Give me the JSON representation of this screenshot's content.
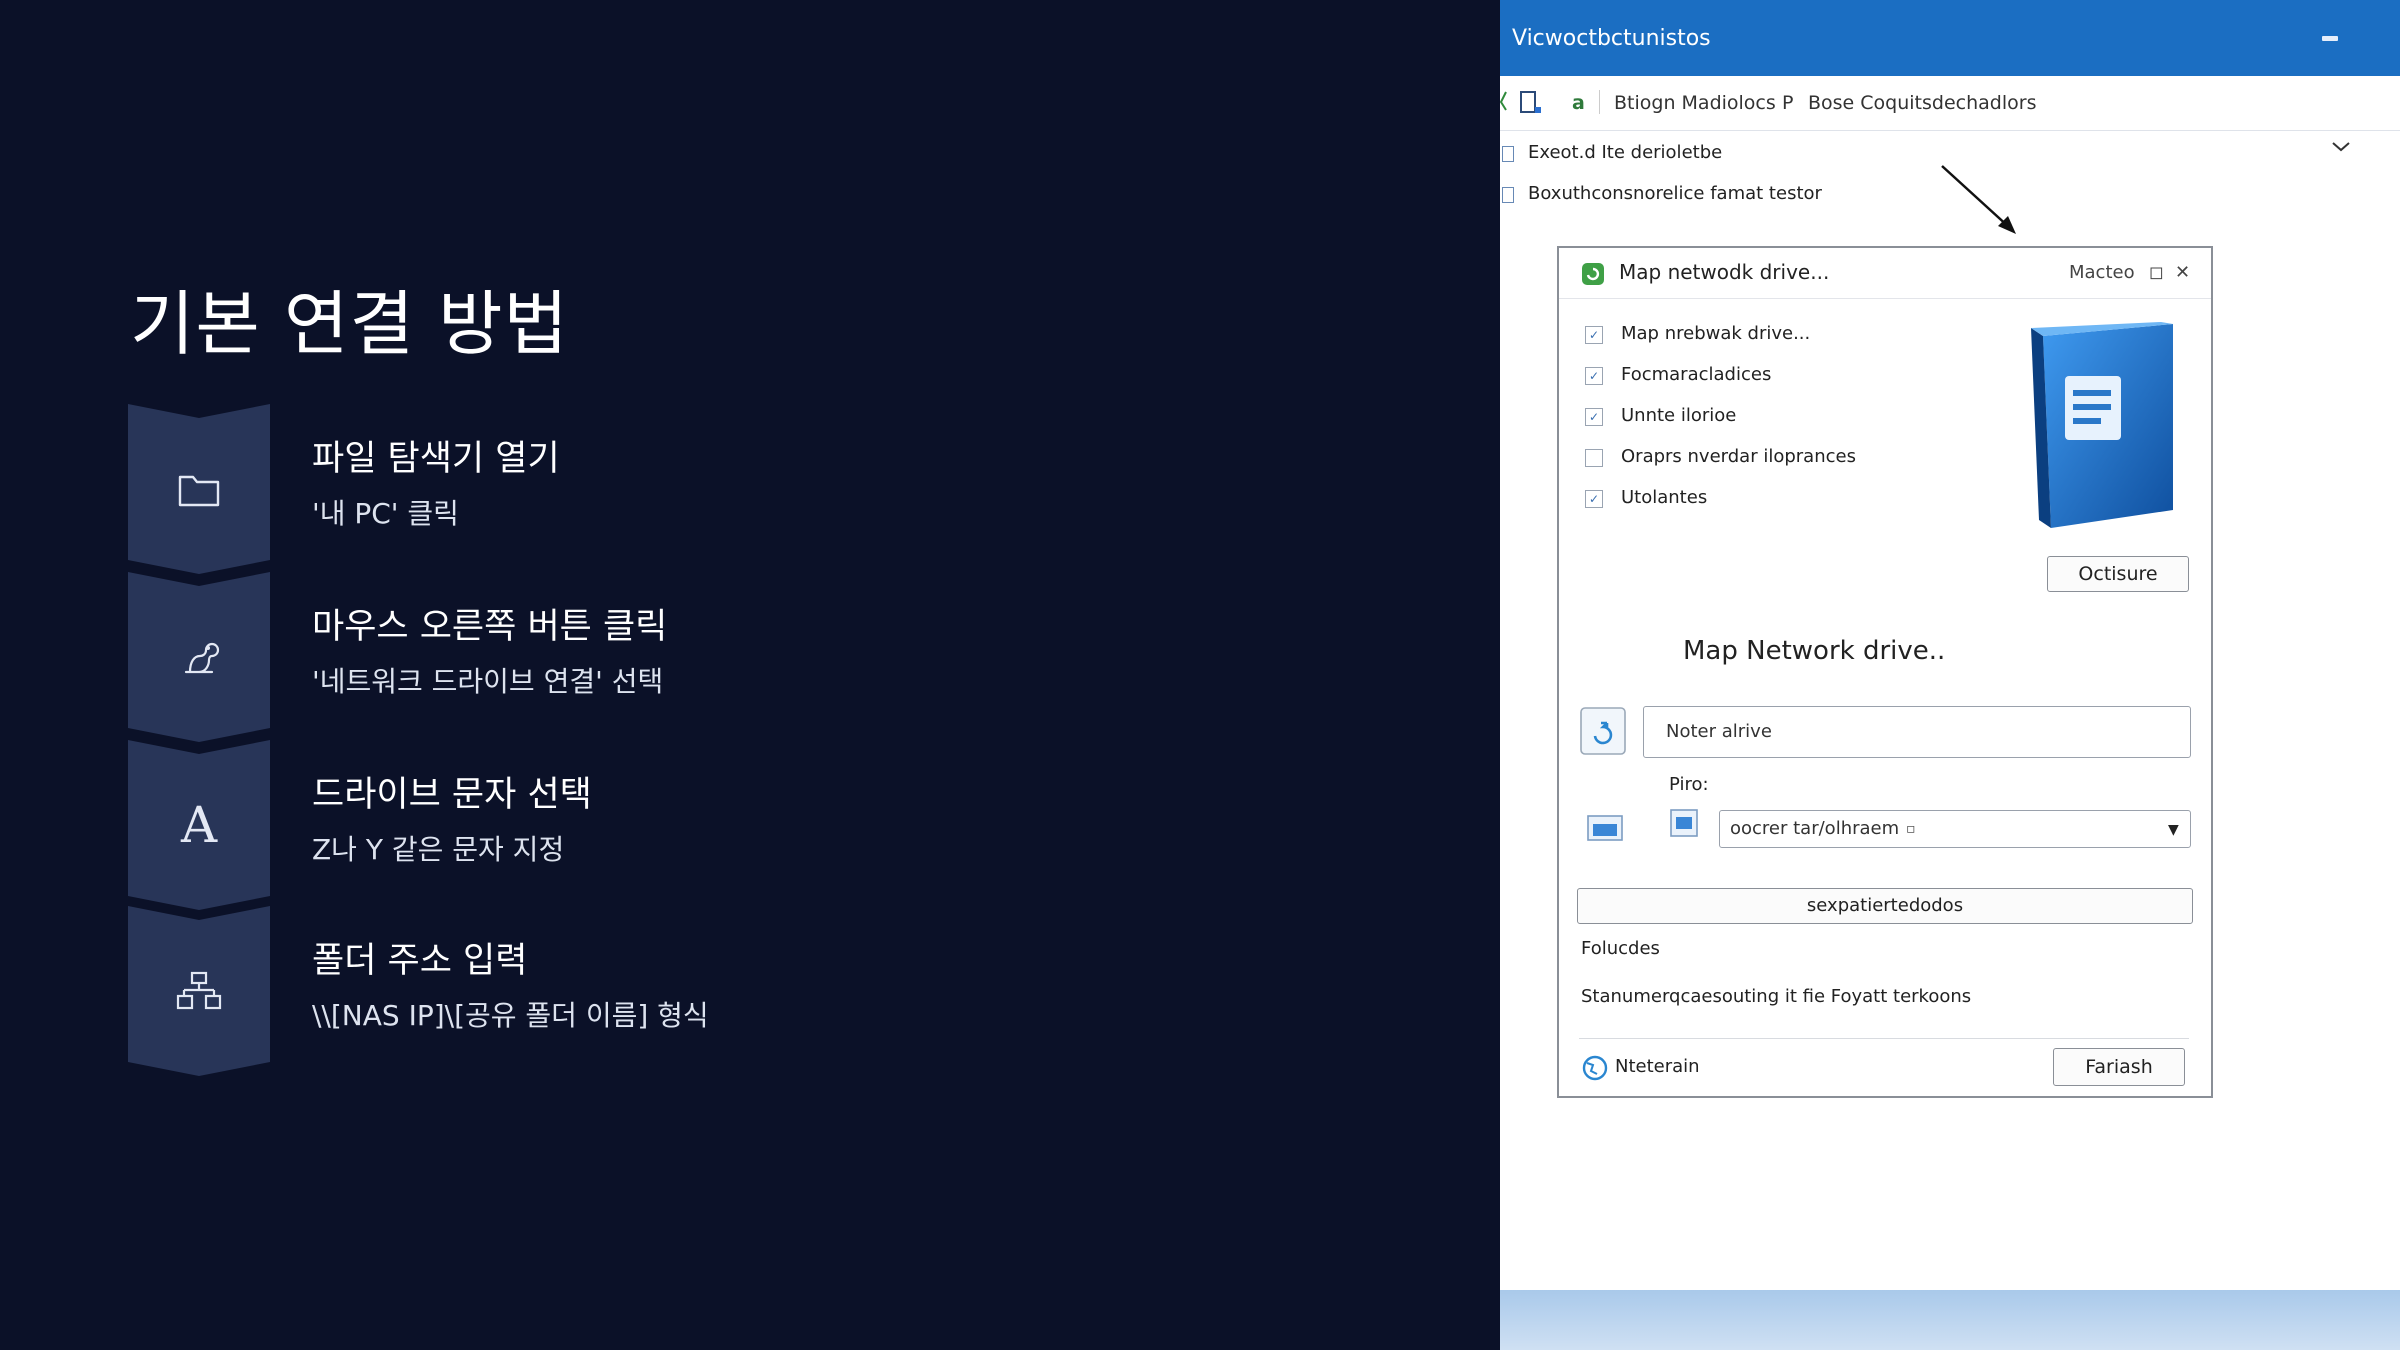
{
  "slide": {
    "title": "기본 연결 방법",
    "steps": [
      {
        "icon": "folder-icon",
        "title": "파일 탐색기 열기",
        "desc": "'내 PC' 클릭"
      },
      {
        "icon": "mouse-click-icon",
        "title": "마우스 오른쪽 버튼 클릭",
        "desc": "'네트워크 드라이브 연결' 선택"
      },
      {
        "icon": "letter-a-icon",
        "glyph": "A",
        "title": "드라이브 문자 선택",
        "desc": "Z나 Y 같은 문자 지정"
      },
      {
        "icon": "network-icon",
        "title": "폴더 주소 입력",
        "desc": "\\\\[NAS IP]\\[공유 폴더 이름] 형식"
      }
    ]
  },
  "window": {
    "title": "Vicwoctbctunistos",
    "toolbar": {
      "item1": "Btiogn Madiolocs",
      "item2": "Bose Coquitsdechadlors"
    },
    "nav": [
      "Exeot.d Ite derioletbe",
      "Boxuthconsnorelice famat testor"
    ],
    "dialog": {
      "title": "Map netwodk drive...",
      "controls": {
        "label": "Macteo",
        "restore": "◻",
        "close": "✕"
      },
      "checks": [
        {
          "label": "Map nrebwak drive...",
          "checked": true
        },
        {
          "label": "Focmaracladices",
          "checked": true
        },
        {
          "label": "Unnte ilorioe",
          "checked": true
        },
        {
          "label": "Oraprs nverdar iloprances",
          "checked": false
        },
        {
          "label": "Utolantes",
          "checked": true
        }
      ],
      "options_button": "Octisure",
      "heading": "Map Network drive..",
      "name_input": "Noter alrive",
      "path_label": "Piro:",
      "path_select": "oocrer tar/olhraem",
      "browse_button": "sexpatiertedodos",
      "folders_label": "Folucdes",
      "info_text": "Stanumerqcaesouting it fie Foyatt terkoons",
      "footer_link": "Nteterain",
      "finish_button": "Fariash"
    }
  }
}
